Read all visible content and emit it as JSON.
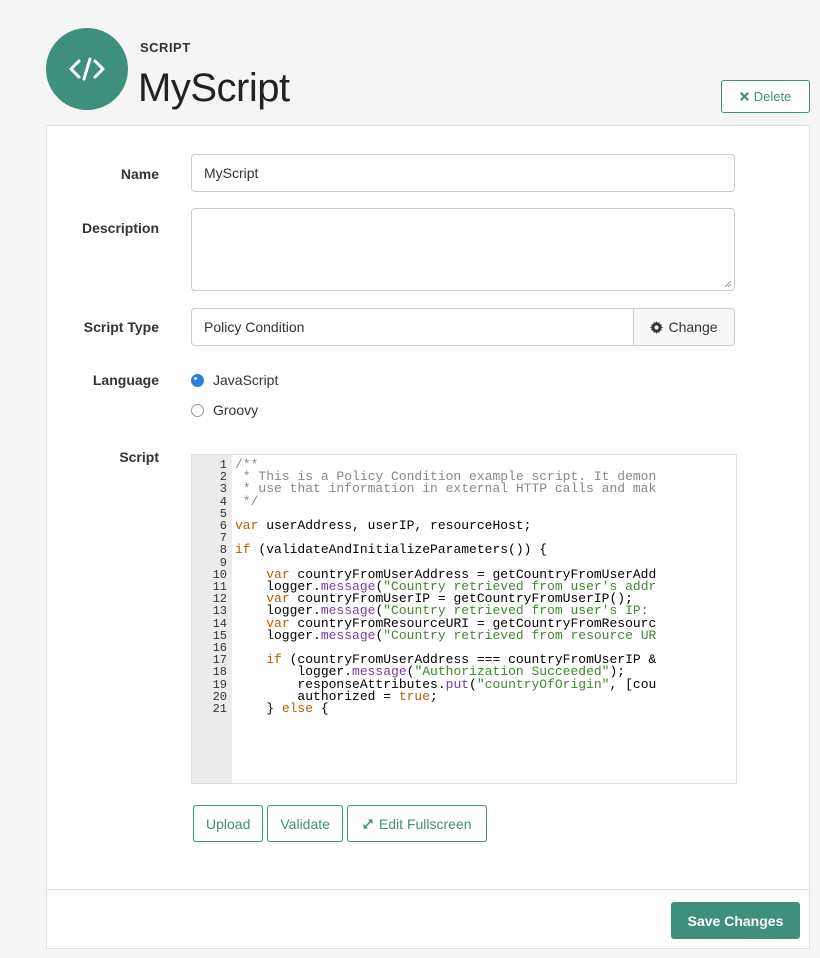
{
  "header": {
    "kicker": "SCRIPT",
    "title": "MyScript",
    "icon": "code-icon",
    "delete_label": "Delete"
  },
  "form": {
    "name": {
      "label": "Name",
      "value": "MyScript"
    },
    "description": {
      "label": "Description",
      "value": ""
    },
    "script_type": {
      "label": "Script Type",
      "value": "Policy Condition",
      "change_label": "Change"
    },
    "language": {
      "label": "Language",
      "options": [
        {
          "label": "JavaScript",
          "selected": true
        },
        {
          "label": "Groovy",
          "selected": false
        }
      ]
    },
    "script": {
      "label": "Script",
      "line_numbers": [
        "1",
        "2",
        "3",
        "4",
        "5",
        "6",
        "7",
        "8",
        "9",
        "10",
        "11",
        "12",
        "13",
        "14",
        "15",
        "16",
        "17",
        "18",
        "19",
        "20",
        "21"
      ],
      "lines": [
        "/**",
        " * This is a Policy Condition example script. It demon",
        " * use that information in external HTTP calls and mak",
        " */",
        "",
        "var userAddress, userIP, resourceHost;",
        "",
        "if (validateAndInitializeParameters()) {",
        "",
        "    var countryFromUserAddress = getCountryFromUserAdd",
        "    logger.message(\"Country retrieved from user's addr",
        "    var countryFromUserIP = getCountryFromUserIP();",
        "    logger.message(\"Country retrieved from user's IP: ",
        "    var countryFromResourceURI = getCountryFromResourc",
        "    logger.message(\"Country retrieved from resource UR",
        "",
        "    if (countryFromUserAddress === countryFromUserIP &",
        "        logger.message(\"Authorization Succeeded\");",
        "        responseAttributes.put(\"countryOfOrigin\", [cou",
        "        authorized = true;",
        "    } else {"
      ],
      "buttons": {
        "upload": "Upload",
        "validate": "Validate",
        "fullscreen": "Edit Fullscreen"
      }
    }
  },
  "footer": {
    "save_label": "Save Changes"
  },
  "colors": {
    "accent": "#3f8f7d",
    "radio": "#2e7fd6"
  }
}
